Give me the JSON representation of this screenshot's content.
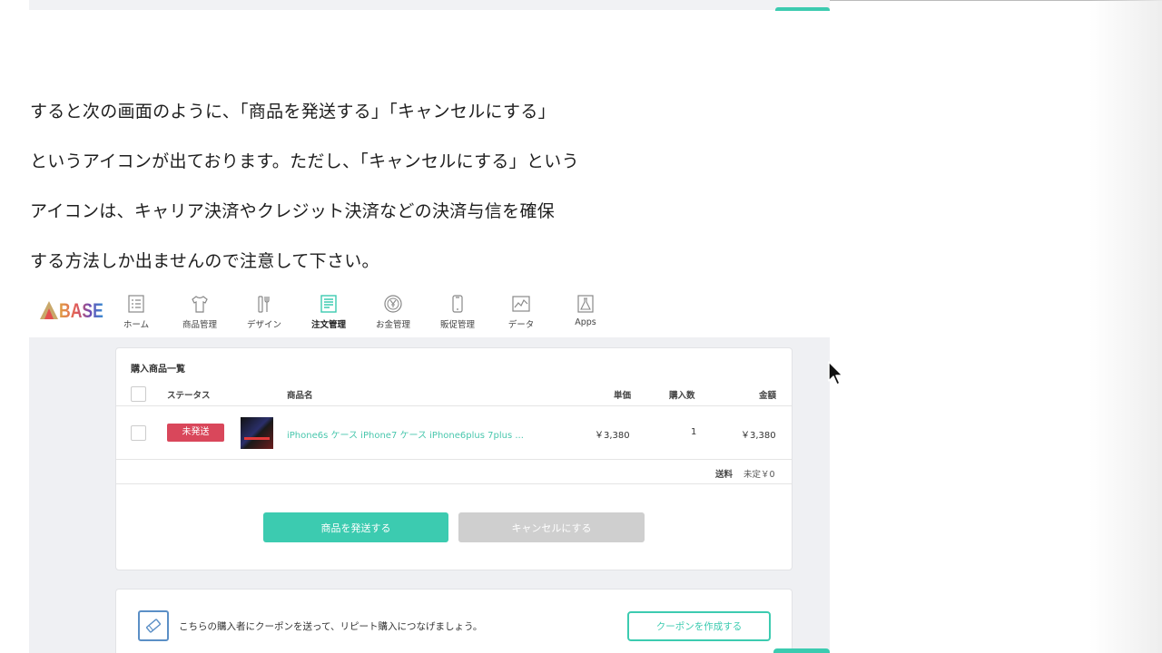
{
  "article": {
    "lines": [
      "すると次の画面のように、「商品を発送する」「キャンセルにする」",
      "というアイコンが出ております。ただし、「キャンセルにする」という",
      "アイコンは、キャリア決済やクレジット決済などの決済与信を確保",
      "する方法しか出ませんので注意して下さい。"
    ]
  },
  "screenshot": {
    "logo": "BASE",
    "nav": [
      {
        "label": "ホーム",
        "icon": "home-list-icon"
      },
      {
        "label": "商品管理",
        "icon": "tshirt-icon"
      },
      {
        "label": "デザイン",
        "icon": "tools-icon"
      },
      {
        "label": "注文管理",
        "icon": "order-document-icon",
        "active": true
      },
      {
        "label": "お金管理",
        "icon": "yen-coin-icon"
      },
      {
        "label": "販促管理",
        "icon": "smartphone-icon"
      },
      {
        "label": "データ",
        "icon": "chart-icon"
      },
      {
        "label": "Apps",
        "icon": "flask-icon"
      }
    ],
    "order_card": {
      "title": "購入商品一覧",
      "columns": {
        "status": "ステータス",
        "name": "商品名",
        "unit_price": "単価",
        "quantity": "購入数",
        "amount": "金額"
      },
      "items": [
        {
          "status": "未発送",
          "name": "iPhone6s ケース iPhone7 ケース iPhone6plus 7plus ...",
          "unit_price": "￥3,380",
          "quantity": "1",
          "amount": "￥3,380"
        }
      ],
      "shipping_label": "送料",
      "shipping_value": "未定￥0",
      "ship_button": "商品を発送する",
      "cancel_button": "キャンセルにする"
    },
    "coupon_card": {
      "text": "こちらの購入者にクーポンを送って、リピート購入につなげましょう。",
      "button": "クーポンを作成する"
    }
  },
  "colors": {
    "accent": "#3ccbb0",
    "status_unshipped": "#d9475b",
    "cancel_disabled": "#cfcfcf",
    "panel_background": "#eff0f3"
  }
}
